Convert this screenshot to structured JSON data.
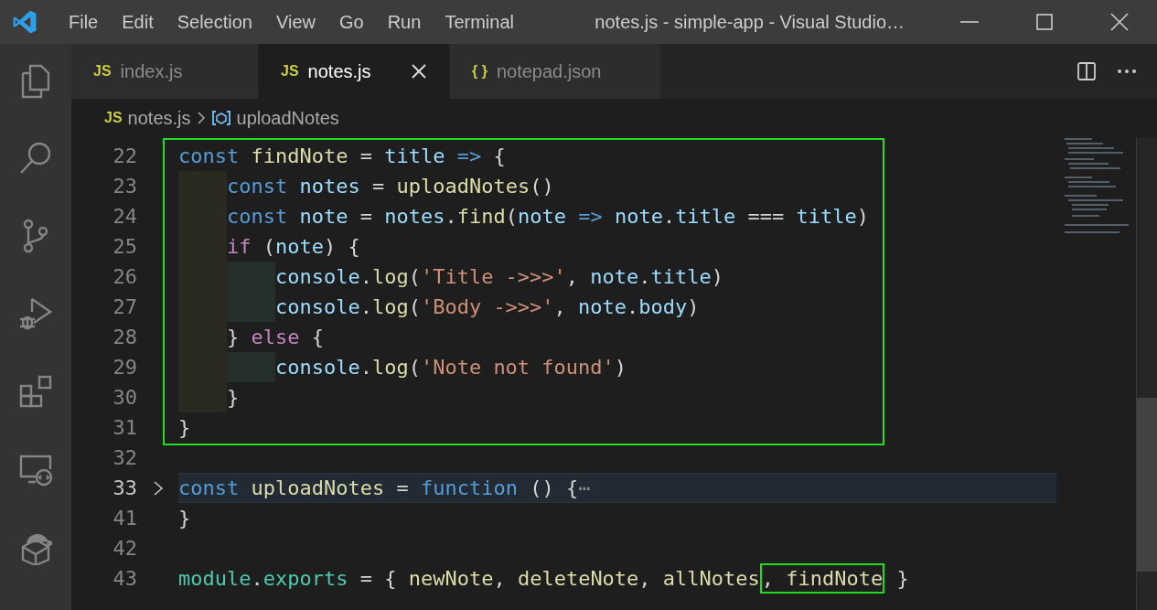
{
  "title_bar": {
    "menu": [
      "File",
      "Edit",
      "Selection",
      "View",
      "Go",
      "Run",
      "Terminal"
    ],
    "title": "notes.js - simple-app - Visual Studio…"
  },
  "activity_bar": {
    "items": [
      {
        "kind": "files"
      },
      {
        "kind": "search"
      },
      {
        "kind": "source-control"
      },
      {
        "kind": "debug"
      },
      {
        "kind": "extensions"
      },
      {
        "kind": "remote"
      },
      {
        "kind": "cube"
      }
    ]
  },
  "tabs": [
    {
      "icon": "JS",
      "label": "index.js",
      "selected": false
    },
    {
      "icon": "JS",
      "label": "notes.js",
      "selected": true
    },
    {
      "icon": "{ }",
      "label": "notepad.json",
      "selected": false
    }
  ],
  "breadcrumb": {
    "icon": "JS",
    "file": "notes.js",
    "symbol": "uploadNotes"
  },
  "editor": {
    "blocks": [
      {
        "kind": "boxed",
        "lines": [
          {
            "number": "22",
            "tokens": [
              {
                "kind": "kw",
                "text": "const "
              },
              {
                "kind": "fn",
                "text": "findNote"
              },
              {
                "kind": "op",
                "text": " = "
              },
              {
                "kind": "var",
                "text": "title "
              },
              {
                "kind": "kw",
                "text": "=>"
              },
              {
                "kind": "op",
                "text": " {"
              }
            ]
          },
          {
            "number": "23",
            "tokens": [
              {
                "kind": "kw",
                "text": "    const "
              },
              {
                "kind": "var",
                "text": "notes"
              },
              {
                "kind": "op",
                "text": " = "
              },
              {
                "kind": "fn",
                "text": "uploadNotes"
              },
              {
                "kind": "op",
                "text": "()"
              }
            ]
          },
          {
            "number": "24",
            "tokens": [
              {
                "kind": "kw",
                "text": "    const "
              },
              {
                "kind": "var",
                "text": "note"
              },
              {
                "kind": "op",
                "text": " = "
              },
              {
                "kind": "var",
                "text": "notes"
              },
              {
                "kind": "op",
                "text": "."
              },
              {
                "kind": "fn",
                "text": "find"
              },
              {
                "kind": "op",
                "text": "("
              },
              {
                "kind": "var",
                "text": "note "
              },
              {
                "kind": "kw",
                "text": "=> "
              },
              {
                "kind": "var",
                "text": "note"
              },
              {
                "kind": "op",
                "text": "."
              },
              {
                "kind": "var",
                "text": "title"
              },
              {
                "kind": "op",
                "text": " === "
              },
              {
                "kind": "var",
                "text": "title"
              },
              {
                "kind": "op",
                "text": ")"
              }
            ]
          },
          {
            "number": "25",
            "tokens": [
              {
                "kind": "ctl",
                "text": "    if"
              },
              {
                "kind": "op",
                "text": " ("
              },
              {
                "kind": "var",
                "text": "note"
              },
              {
                "kind": "op",
                "text": ") {"
              }
            ]
          },
          {
            "number": "26",
            "tokens": [
              {
                "kind": "var",
                "text": "        console"
              },
              {
                "kind": "op",
                "text": "."
              },
              {
                "kind": "fn",
                "text": "log"
              },
              {
                "kind": "op",
                "text": "("
              },
              {
                "kind": "str",
                "text": "'Title ->>>'"
              },
              {
                "kind": "op",
                "text": ", "
              },
              {
                "kind": "var",
                "text": "note"
              },
              {
                "kind": "op",
                "text": "."
              },
              {
                "kind": "var",
                "text": "title"
              },
              {
                "kind": "op",
                "text": ")"
              }
            ]
          },
          {
            "number": "27",
            "tokens": [
              {
                "kind": "var",
                "text": "        console"
              },
              {
                "kind": "op",
                "text": "."
              },
              {
                "kind": "fn",
                "text": "log"
              },
              {
                "kind": "op",
                "text": "("
              },
              {
                "kind": "str",
                "text": "'Body ->>>'"
              },
              {
                "kind": "op",
                "text": ", "
              },
              {
                "kind": "var",
                "text": "note"
              },
              {
                "kind": "op",
                "text": "."
              },
              {
                "kind": "var",
                "text": "body"
              },
              {
                "kind": "op",
                "text": ")"
              }
            ]
          },
          {
            "number": "28",
            "tokens": [
              {
                "kind": "op",
                "text": "    } "
              },
              {
                "kind": "ctl",
                "text": "else"
              },
              {
                "kind": "op",
                "text": " {"
              }
            ]
          },
          {
            "number": "29",
            "tokens": [
              {
                "kind": "var",
                "text": "        console"
              },
              {
                "kind": "op",
                "text": "."
              },
              {
                "kind": "fn",
                "text": "log"
              },
              {
                "kind": "op",
                "text": "("
              },
              {
                "kind": "str",
                "text": "'Note not found'"
              },
              {
                "kind": "op",
                "text": ")"
              }
            ]
          },
          {
            "number": "30",
            "tokens": [
              {
                "kind": "op",
                "text": "    }"
              }
            ]
          },
          {
            "number": "31",
            "tokens": [
              {
                "kind": "op",
                "text": "}"
              }
            ]
          }
        ]
      },
      {
        "kind": "plain",
        "lines": [
          {
            "number": "32"
          },
          {
            "number": "33",
            "folded": true,
            "current": true,
            "tokens": [
              {
                "kind": "kw",
                "text": "const "
              },
              {
                "kind": "fn",
                "text": "uploadNotes"
              },
              {
                "kind": "op",
                "text": " = "
              },
              {
                "kind": "kw",
                "text": "function"
              },
              {
                "kind": "op",
                "text": " () {"
              },
              {
                "kind": "fold",
                "text": "⋯"
              }
            ]
          },
          {
            "number": "41",
            "tokens": [
              {
                "kind": "op",
                "text": "}"
              }
            ]
          },
          {
            "number": "42"
          },
          {
            "number": "43",
            "tokens": [
              {
                "kind": "mod",
                "text": "module"
              },
              {
                "kind": "op",
                "text": "."
              },
              {
                "kind": "mod",
                "text": "exports"
              },
              {
                "kind": "op",
                "text": " = { "
              },
              {
                "kind": "fn",
                "text": "newNote"
              },
              {
                "kind": "op",
                "text": ", "
              },
              {
                "kind": "fn",
                "text": "deleteNote"
              },
              {
                "kind": "op",
                "text": ", "
              },
              {
                "kind": "fn",
                "text": "allNotes"
              },
              {
                "kind": "box",
                "tokens": [
                  {
                    "kind": "op",
                    "text": ", "
                  },
                  {
                    "kind": "fn",
                    "text": "findNote"
                  }
                ]
              },
              {
                "kind": "op",
                "text": " }"
              }
            ]
          }
        ]
      }
    ]
  }
}
